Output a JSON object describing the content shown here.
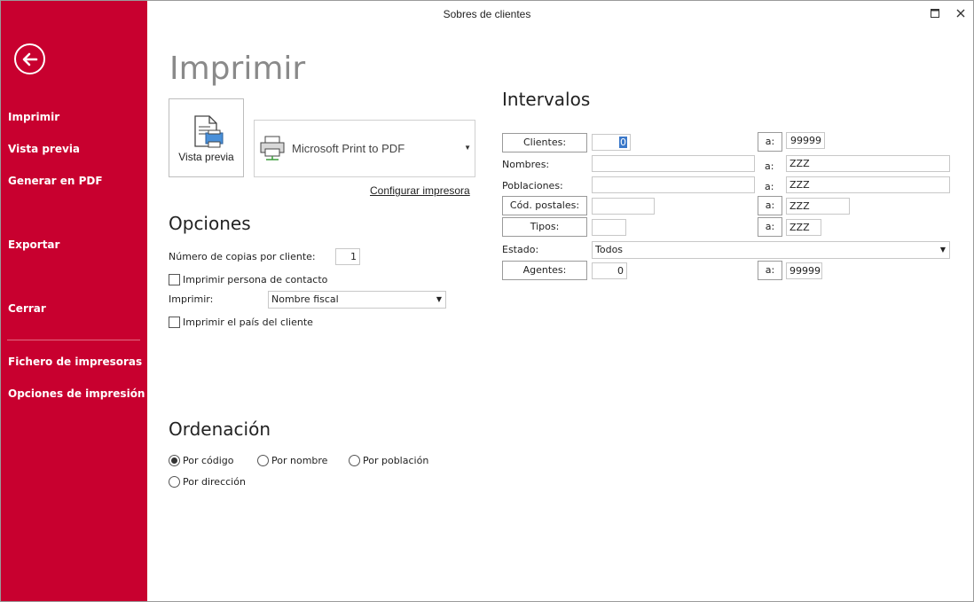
{
  "window": {
    "title": "Sobres de clientes",
    "maximize_glyph": "🗖",
    "close_glyph": "✕"
  },
  "sidebar": {
    "back_glyph": "🡐",
    "items": [
      {
        "label": "Imprimir"
      },
      {
        "label": "Vista previa"
      },
      {
        "label": "Generar en PDF"
      },
      {
        "label": "Exportar"
      },
      {
        "label": "Cerrar"
      },
      {
        "label": "Fichero de impresoras"
      },
      {
        "label": "Opciones de impresión"
      }
    ]
  },
  "main": {
    "heading": "Imprimir",
    "preview_button": {
      "label": "Vista previa",
      "icon": "document-preview-icon"
    },
    "printer": {
      "name": "Microsoft Print to PDF",
      "icon": "printer-icon"
    },
    "configure_link": "Configurar impresora"
  },
  "opciones": {
    "heading": "Opciones",
    "copies_label": "Número de copias por cliente:",
    "copies_value": "1",
    "print_contact_label": "Imprimir persona de contacto",
    "print_contact_checked": false,
    "imprimir_label": "Imprimir:",
    "imprimir_value": "Nombre fiscal",
    "print_country_label": "Imprimir el país del cliente",
    "print_country_checked": false
  },
  "ordenacion": {
    "heading": "Ordenación",
    "options": [
      {
        "label": "Por código",
        "selected": true
      },
      {
        "label": "Por nombre",
        "selected": false
      },
      {
        "label": "Por población",
        "selected": false
      },
      {
        "label": "Por dirección",
        "selected": false
      }
    ]
  },
  "intervalos": {
    "heading": "Intervalos",
    "a_label": "a:",
    "clientes": {
      "label": "Clientes:",
      "from": "0",
      "to": "99999"
    },
    "nombres": {
      "label": "Nombres:",
      "from": "",
      "to": "ZZZ"
    },
    "poblaciones": {
      "label": "Poblaciones:",
      "from": "",
      "to": "ZZZ"
    },
    "cod_postales": {
      "label": "Cód. postales:",
      "from": "",
      "to": "ZZZ"
    },
    "tipos": {
      "label": "Tipos:",
      "from": "",
      "to": "ZZZ"
    },
    "estado": {
      "label": "Estado:",
      "value": "Todos"
    },
    "agentes": {
      "label": "Agentes:",
      "from": "0",
      "to": "99999"
    }
  },
  "colors": {
    "sidebar_bg": "#c8002f",
    "heading_gray": "#8a8a8a"
  }
}
